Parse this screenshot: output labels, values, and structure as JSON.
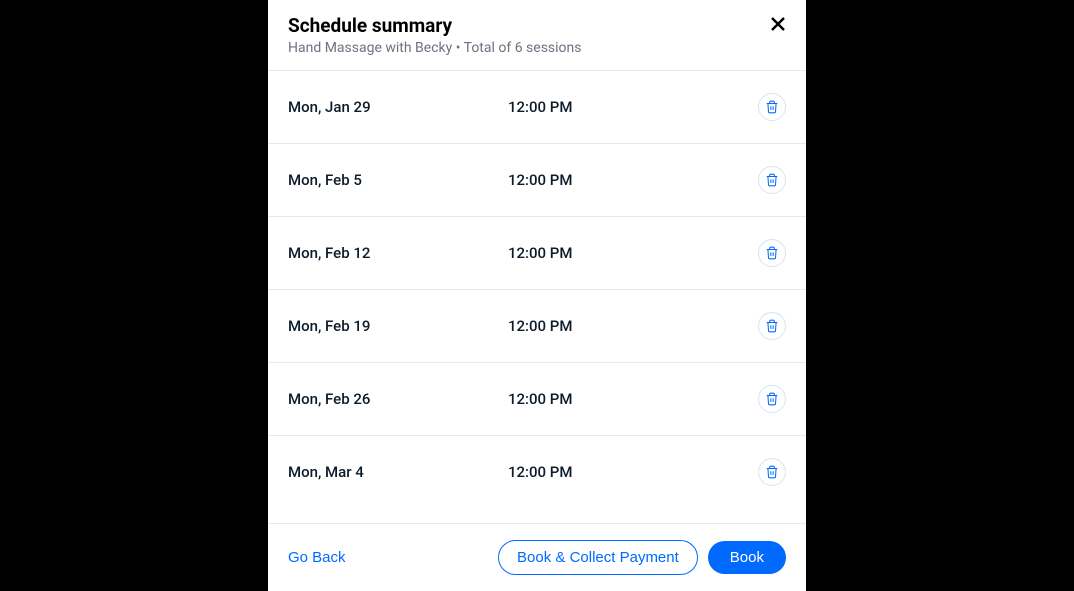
{
  "header": {
    "title": "Schedule summary",
    "subtitle": "Hand Massage with Becky • Total of 6 sessions"
  },
  "sessions": [
    {
      "date": "Mon, Jan 29",
      "time": "12:00 PM"
    },
    {
      "date": "Mon, Feb 5",
      "time": "12:00 PM"
    },
    {
      "date": "Mon, Feb 12",
      "time": "12:00 PM"
    },
    {
      "date": "Mon, Feb 19",
      "time": "12:00 PM"
    },
    {
      "date": "Mon, Feb 26",
      "time": "12:00 PM"
    },
    {
      "date": "Mon, Mar 4",
      "time": "12:00 PM"
    }
  ],
  "footer": {
    "go_back": "Go Back",
    "book_collect": "Book & Collect Payment",
    "book": "Book"
  }
}
